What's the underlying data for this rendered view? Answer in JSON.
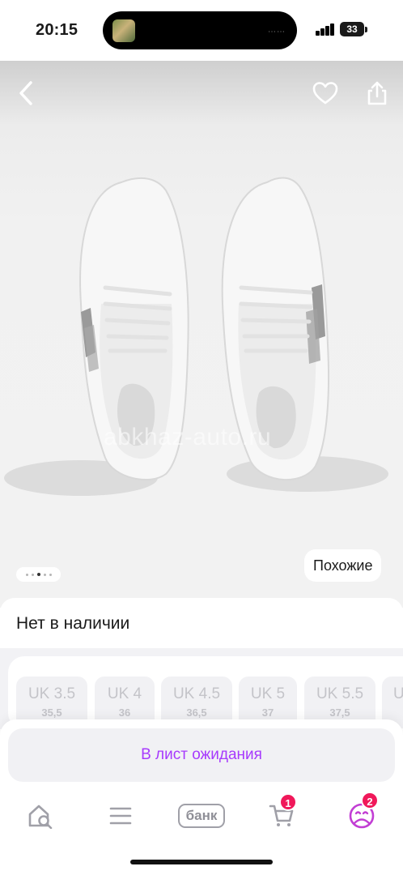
{
  "status_bar": {
    "time": "20:15",
    "battery": "33",
    "icons": [
      "music-thumbnail-icon",
      "audio-wave-icon",
      "signal-icon",
      "battery-icon"
    ]
  },
  "header": {
    "icons": [
      "back-chevron-icon",
      "heart-icon",
      "share-icon"
    ]
  },
  "gallery": {
    "watermark": "abkhaz-auto.ru",
    "similar_label": "Похожие",
    "page_count": 5,
    "active_page": 3
  },
  "product": {
    "availability": "Нет в наличии"
  },
  "sizes": [
    {
      "uk": "UK 3.5",
      "eu": "35,5"
    },
    {
      "uk": "UK 4",
      "eu": "36"
    },
    {
      "uk": "UK 4.5",
      "eu": "36,5"
    },
    {
      "uk": "UK 5",
      "eu": "37"
    },
    {
      "uk": "UK 5.5",
      "eu": "37,5"
    },
    {
      "uk": "UK",
      "eu": ""
    }
  ],
  "actions": {
    "waitlist_label": "В лист ожидания"
  },
  "tabbar": {
    "bank_label": "банк",
    "cart_badge": "1",
    "profile_badge": "2",
    "icons": [
      "home-search-icon",
      "catalog-menu-icon",
      "bank-icon",
      "cart-icon",
      "profile-icon"
    ]
  },
  "colors": {
    "accent": "#a73afd",
    "badge": "#f0185a",
    "profile": "#c23ed4"
  }
}
